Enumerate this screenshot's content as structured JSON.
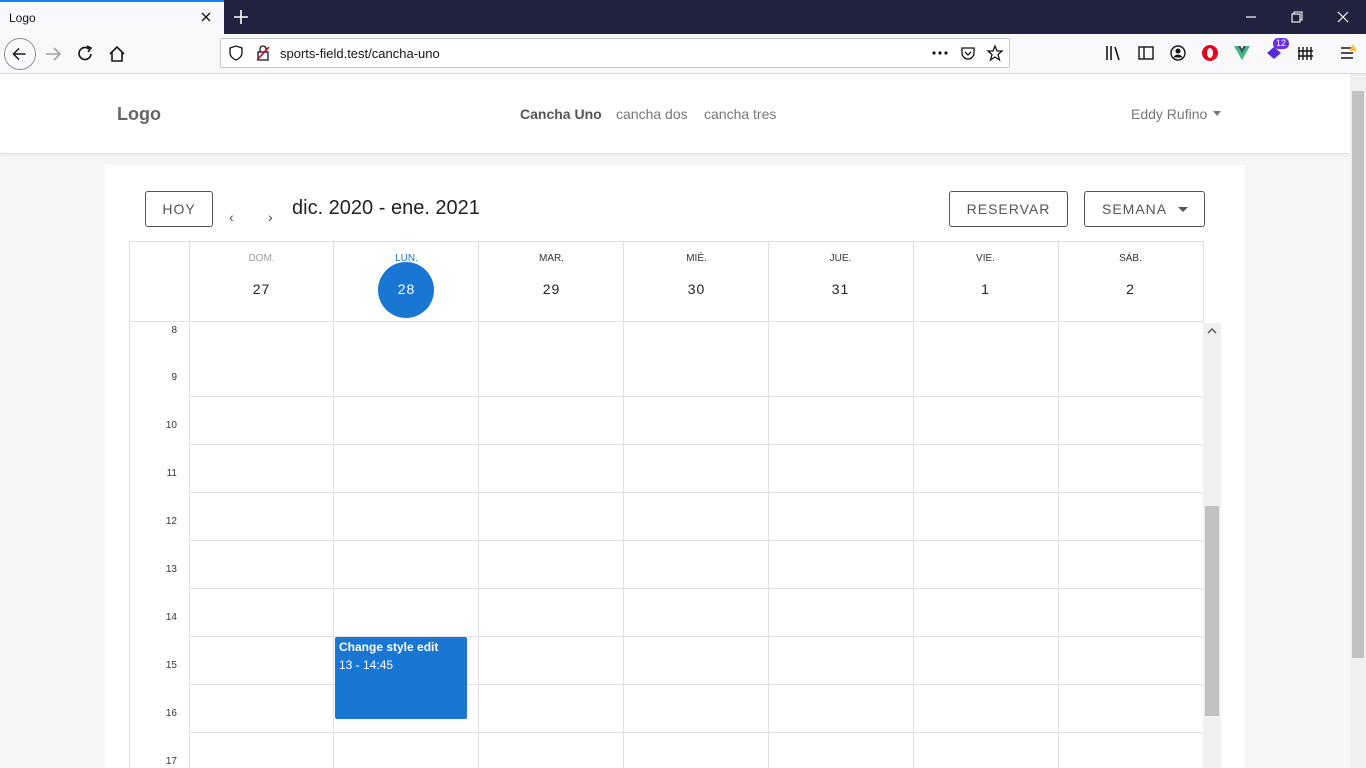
{
  "browser": {
    "tab_title": "Logo",
    "url": "sports-field.test/cancha-uno",
    "toolbar_badge": "12"
  },
  "header": {
    "logo": "Logo",
    "nav": [
      "Cancha Uno",
      "cancha dos",
      "cancha tres"
    ],
    "active_nav": "Cancha Uno",
    "user": "Eddy Rufino"
  },
  "toolbar": {
    "today": "HOY",
    "prev": "‹",
    "next": "›",
    "range": "dic. 2020 - ene. 2021",
    "reserve": "RESERVAR",
    "view": "SEMANA"
  },
  "calendar": {
    "days": [
      {
        "name": "DOM.",
        "num": "27"
      },
      {
        "name": "LUN.",
        "num": "28",
        "today": true
      },
      {
        "name": "MAR.",
        "num": "29"
      },
      {
        "name": "MIÉ.",
        "num": "30"
      },
      {
        "name": "JUE.",
        "num": "31"
      },
      {
        "name": "VIE.",
        "num": "1"
      },
      {
        "name": "SÁB.",
        "num": "2"
      }
    ],
    "hours": [
      "8",
      "9",
      "10",
      "11",
      "12",
      "13",
      "14",
      "15",
      "16",
      "17"
    ],
    "event": {
      "title": "Change style edit",
      "time": "13 - 14:45"
    }
  },
  "colors": {
    "accent": "#1976d2",
    "tabbar": "#202340"
  }
}
